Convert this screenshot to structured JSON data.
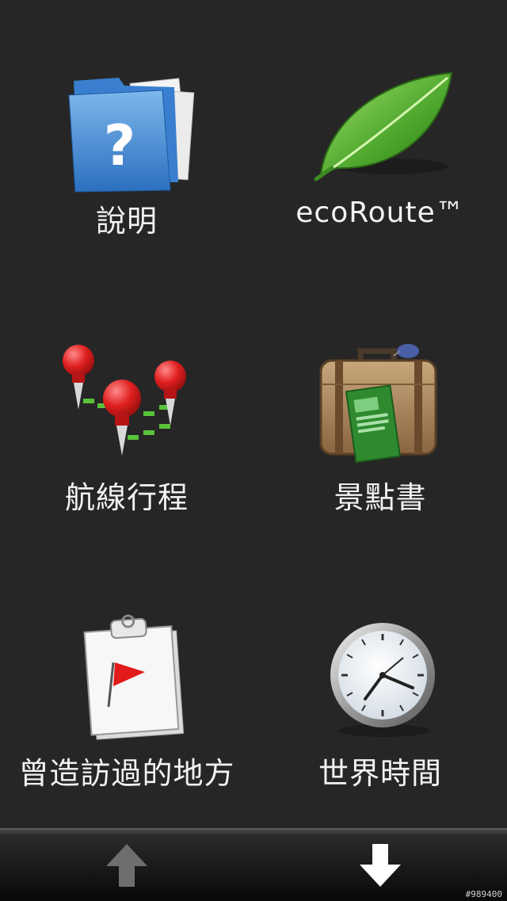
{
  "menu": {
    "items": [
      {
        "label": "說明",
        "icon": "help-folder-icon"
      },
      {
        "label": "ecoRoute™",
        "icon": "leaf-icon"
      },
      {
        "label": "航線行程",
        "icon": "route-pins-icon"
      },
      {
        "label": "景點書",
        "icon": "suitcase-guidebook-icon"
      },
      {
        "label": "曾造訪過的地方",
        "icon": "clipboard-flag-icon"
      },
      {
        "label": "世界時間",
        "icon": "clock-icon"
      }
    ]
  },
  "nav": {
    "up_icon": "arrow-up-icon",
    "down_icon": "arrow-down-icon",
    "up_enabled": false,
    "down_enabled": true
  },
  "watermark": "#989400",
  "colors": {
    "background": "#262626",
    "text": "#f2f2f2",
    "up_arrow_disabled": "#6e6e6e",
    "down_arrow_enabled": "#ffffff"
  }
}
